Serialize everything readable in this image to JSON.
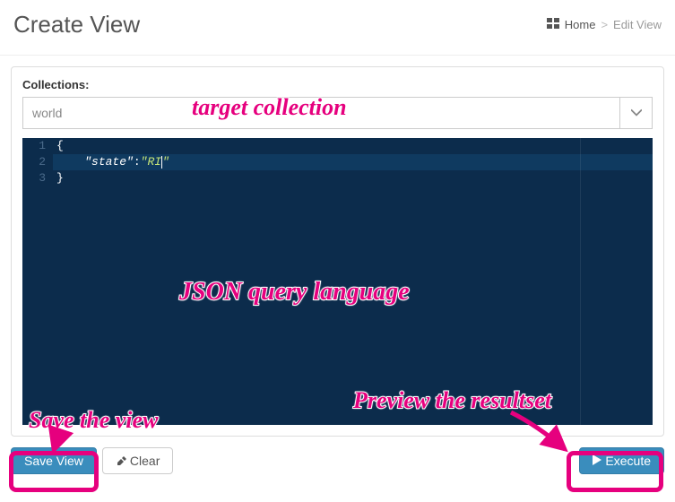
{
  "header": {
    "title": "Create View",
    "breadcrumb": {
      "home": "Home",
      "current": "Edit View"
    }
  },
  "form": {
    "collections_label": "Collections:",
    "selected_collection": "world"
  },
  "editor": {
    "lines": [
      {
        "n": "1",
        "text": "{"
      },
      {
        "n": "2",
        "text": "    \"state\":\"RI\""
      },
      {
        "n": "3",
        "text": "}"
      }
    ]
  },
  "buttons": {
    "save": "Save View",
    "clear": "Clear",
    "execute": "Execute"
  },
  "annotations": {
    "target": "target collection",
    "json": "JSON query language",
    "preview": "Preview the resultset",
    "save": "Save the view"
  }
}
